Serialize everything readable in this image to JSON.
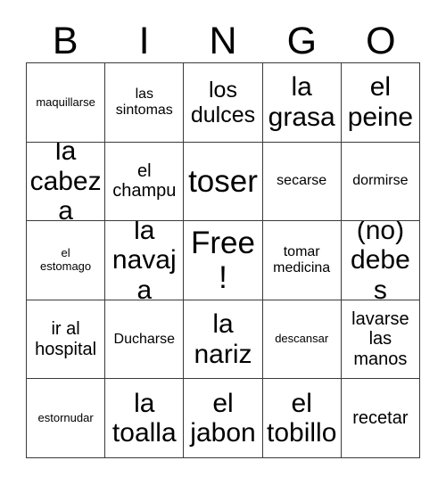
{
  "card": {
    "header_letters": [
      "B",
      "I",
      "N",
      "G",
      "O"
    ],
    "cells": [
      {
        "text": "maquillarse",
        "size": "xs"
      },
      {
        "text": "las\nsintomas",
        "size": "sm"
      },
      {
        "text": "los\ndulces",
        "size": "lg"
      },
      {
        "text": "la\ngrasa",
        "size": "xl"
      },
      {
        "text": "el\npeine",
        "size": "xl"
      },
      {
        "text": "la\ncabeza",
        "size": "xl"
      },
      {
        "text": "el\nchampu",
        "size": "md"
      },
      {
        "text": "toser",
        "size": "xxl"
      },
      {
        "text": "secarse",
        "size": "sm"
      },
      {
        "text": "dormirse",
        "size": "sm"
      },
      {
        "text": "el\nestomago",
        "size": "xs"
      },
      {
        "text": "la\nnavaja",
        "size": "xl"
      },
      {
        "text": "Free!",
        "size": "xxl"
      },
      {
        "text": "tomar\nmedicina",
        "size": "sm"
      },
      {
        "text": "(no)\ndebes",
        "size": "xl"
      },
      {
        "text": "ir al\nhospital",
        "size": "md"
      },
      {
        "text": "Ducharse",
        "size": "sm"
      },
      {
        "text": "la\nnariz",
        "size": "xl"
      },
      {
        "text": "descansar",
        "size": "xs"
      },
      {
        "text": "lavarse\nlas\nmanos",
        "size": "md"
      },
      {
        "text": "estornudar",
        "size": "xs"
      },
      {
        "text": "la\ntoalla",
        "size": "xl"
      },
      {
        "text": "el\njabon",
        "size": "xl"
      },
      {
        "text": "el\ntobillo",
        "size": "xl"
      },
      {
        "text": "recetar",
        "size": "md"
      }
    ]
  },
  "colors": {
    "border": "#3a3a3a",
    "text": "#000000",
    "background": "#ffffff"
  }
}
